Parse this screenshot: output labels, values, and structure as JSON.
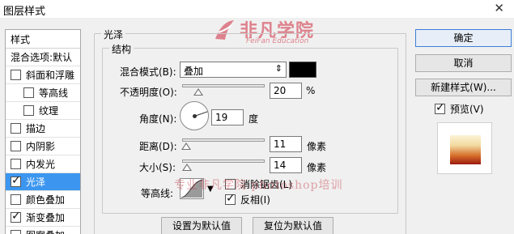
{
  "window": {
    "title": "图层样式",
    "close_label": "✕"
  },
  "watermark": {
    "brand": "非凡学院",
    "brand_sub": "FeiFan Education",
    "caption": "专业非凡学院 photoshop培训",
    "color": "#cd283c"
  },
  "styles": {
    "header": "样式",
    "blend_options": "混合选项:默认",
    "items": [
      {
        "label": "斜面和浮雕",
        "checked": false,
        "indent": false
      },
      {
        "label": "等高线",
        "checked": false,
        "indent": true
      },
      {
        "label": "纹理",
        "checked": false,
        "indent": true
      },
      {
        "label": "描边",
        "checked": false,
        "indent": false
      },
      {
        "label": "内阴影",
        "checked": false,
        "indent": false
      },
      {
        "label": "内发光",
        "checked": false,
        "indent": false
      },
      {
        "label": "光泽",
        "checked": true,
        "indent": false,
        "selected": true
      },
      {
        "label": "颜色叠加",
        "checked": false,
        "indent": false
      },
      {
        "label": "渐变叠加",
        "checked": true,
        "indent": false
      },
      {
        "label": "图案叠加",
        "checked": false,
        "indent": false
      }
    ],
    "selected_color": "#3c96f0"
  },
  "satin": {
    "group_title": "光泽",
    "structure_title": "结构",
    "blend_mode_label": "混合模式(B):",
    "blend_mode_value": "叠加",
    "blend_color": "#000000",
    "opacity_label": "不透明度(O):",
    "opacity_value": "20",
    "opacity_unit": "%",
    "opacity_fraction": 0.2,
    "angle_label": "角度(N):",
    "angle_value": "19",
    "angle_unit": "度",
    "distance_label": "距离(D):",
    "distance_value": "11",
    "distance_unit": "像素",
    "distance_fraction": 0.05,
    "size_label": "大小(S):",
    "size_value": "14",
    "size_unit": "像素",
    "size_fraction": 0.06,
    "contour_label": "等高线:",
    "anti_alias_label": "消除锯齿(L)",
    "anti_alias_checked": false,
    "invert_label": "反相(I)",
    "invert_checked": true,
    "set_default_label": "设置为默认值",
    "reset_default_label": "复位为默认值"
  },
  "actions": {
    "ok_label": "确定",
    "cancel_label": "取消",
    "new_style_label": "新建样式(W)...",
    "preview_label": "预览(V)",
    "preview_checked": true
  }
}
